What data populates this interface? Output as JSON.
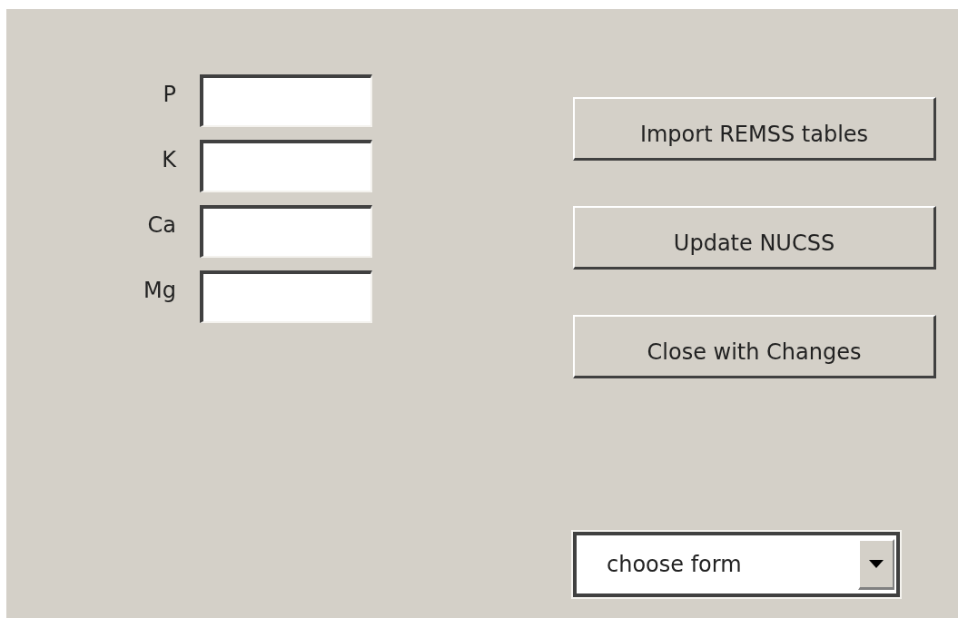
{
  "fields": [
    {
      "label": "P"
    },
    {
      "label": "K"
    },
    {
      "label": "Ca"
    },
    {
      "label": "Mg"
    }
  ],
  "buttons": [
    "Import REMSS tables",
    "Update NUCSS",
    "Close with Changes"
  ],
  "dropdown": {
    "value": "choose form"
  }
}
